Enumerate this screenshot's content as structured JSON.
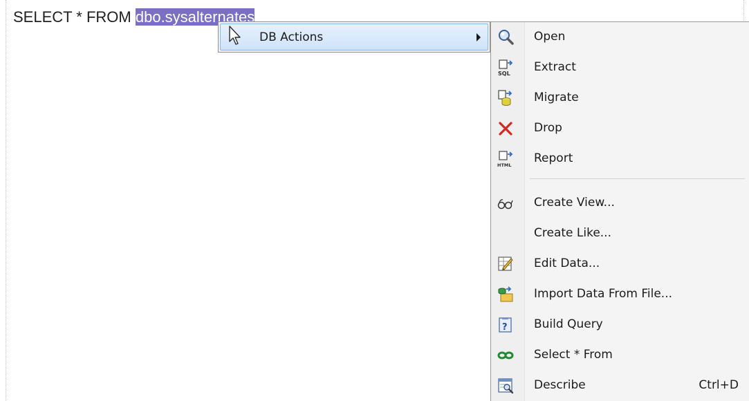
{
  "editor": {
    "sql_prefix": "SELECT * FROM ",
    "sql_selection": "dbo.sysalternates"
  },
  "context_menu": {
    "item_label": "DB Actions",
    "highlight_color": "#cfe3f9"
  },
  "submenu": {
    "items": [
      {
        "label": "Open",
        "icon": "magnifier-icon"
      },
      {
        "label": "Extract",
        "icon": "sql-extract-icon"
      },
      {
        "label": "Migrate",
        "icon": "migrate-icon"
      },
      {
        "label": "Drop",
        "icon": "red-x-icon"
      },
      {
        "label": "Report",
        "icon": "html-report-icon"
      },
      {
        "label": "Create View...",
        "icon": "glasses-icon"
      },
      {
        "label": "Create Like...",
        "icon": ""
      },
      {
        "label": "Edit Data...",
        "icon": "edit-table-icon"
      },
      {
        "label": "Import Data From File...",
        "icon": "import-icon"
      },
      {
        "label": "Build Query",
        "icon": "query-builder-icon"
      },
      {
        "label": "Select * From",
        "icon": "select-from-icon"
      },
      {
        "label": "Describe",
        "icon": "describe-icon",
        "shortcut": "Ctrl+D"
      }
    ]
  }
}
